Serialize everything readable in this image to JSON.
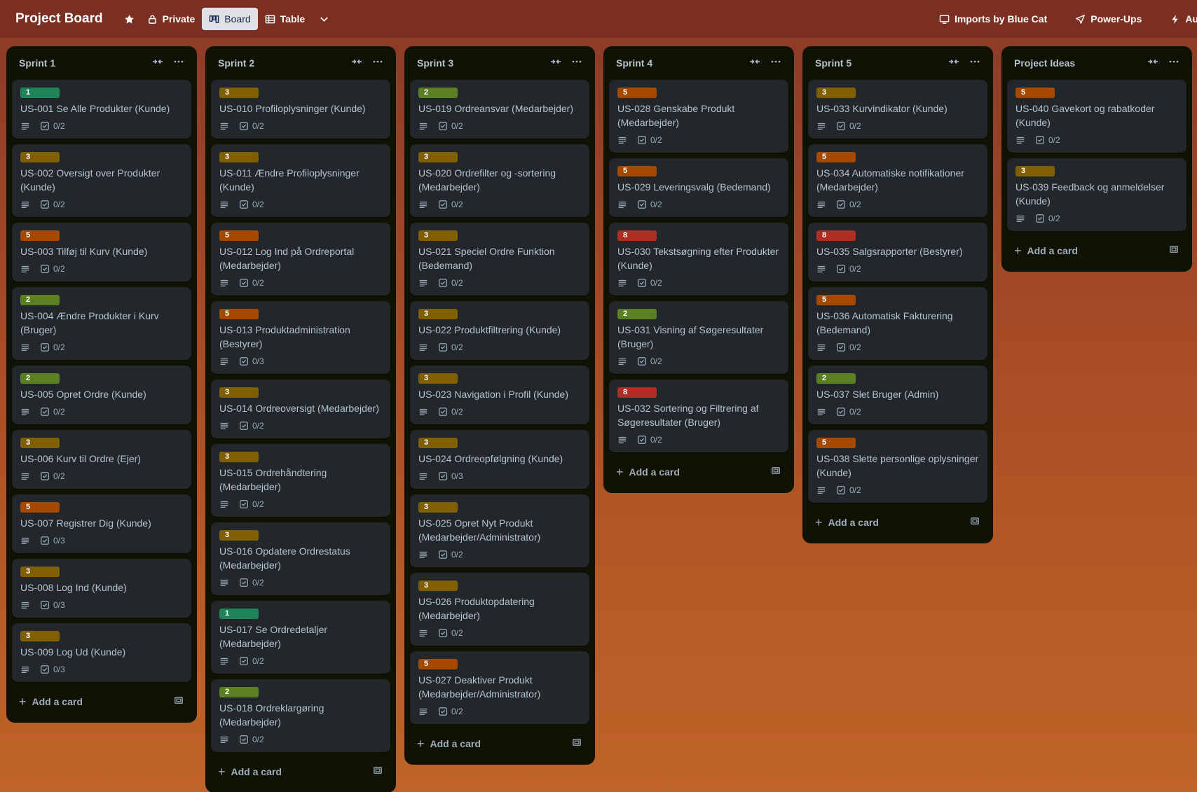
{
  "topbar": {
    "board_title": "Project Board",
    "visibility": "Private",
    "views": [
      "Board",
      "Table"
    ],
    "right_items": [
      "Imports by Blue Cat",
      "Power-Ups",
      "Automa"
    ]
  },
  "label_colors": {
    "1": "#1f845a",
    "2": "#5b7f24",
    "3": "#7f5f01",
    "5": "#a54800",
    "8": "#ae2e24"
  },
  "add_card_label": "Add a card",
  "lists": [
    {
      "title": "Sprint 1",
      "cards": [
        {
          "points": "1",
          "title": "US-001 Se Alle Produkter (Kunde)",
          "checklist": "0/2"
        },
        {
          "points": "3",
          "title": "US-002 Oversigt over Produkter (Kunde)",
          "checklist": "0/2"
        },
        {
          "points": "5",
          "title": "US-003 Tilføj til Kurv (Kunde)",
          "checklist": "0/2"
        },
        {
          "points": "2",
          "title": "US-004 Ændre Produkter i Kurv (Bruger)",
          "checklist": "0/2"
        },
        {
          "points": "2",
          "title": "US-005 Opret Ordre (Kunde)",
          "checklist": "0/2"
        },
        {
          "points": "3",
          "title": "US-006 Kurv til Ordre (Ejer)",
          "checklist": "0/2"
        },
        {
          "points": "5",
          "title": "US-007 Registrer Dig (Kunde)",
          "checklist": "0/3"
        },
        {
          "points": "3",
          "title": "US-008 Log Ind (Kunde)",
          "checklist": "0/3"
        },
        {
          "points": "3",
          "title": "US-009 Log Ud (Kunde)",
          "checklist": "0/3"
        }
      ]
    },
    {
      "title": "Sprint 2",
      "cards": [
        {
          "points": "3",
          "title": "US-010 Profiloplysninger (Kunde)",
          "checklist": "0/2"
        },
        {
          "points": "3",
          "title": "US-011 Ændre Profiloplysninger (Kunde)",
          "checklist": "0/2"
        },
        {
          "points": "5",
          "title": "US-012 Log Ind på Ordreportal (Medarbejder)",
          "checklist": "0/2"
        },
        {
          "points": "5",
          "title": "US-013 Produktadministration (Bestyrer)",
          "checklist": "0/3"
        },
        {
          "points": "3",
          "title": "US-014 Ordreoversigt (Medarbejder)",
          "checklist": "0/2"
        },
        {
          "points": "3",
          "title": "US-015 Ordrehåndtering (Medarbejder)",
          "checklist": "0/2"
        },
        {
          "points": "3",
          "title": "US-016 Opdatere Ordrestatus (Medarbejder)",
          "checklist": "0/2"
        },
        {
          "points": "1",
          "title": "US-017 Se Ordredetaljer (Medarbejder)",
          "checklist": "0/2"
        },
        {
          "points": "2",
          "title": "US-018 Ordreklargøring (Medarbejder)",
          "checklist": "0/2"
        }
      ]
    },
    {
      "title": "Sprint 3",
      "cards": [
        {
          "points": "2",
          "title": "US-019 Ordreansvar (Medarbejder)",
          "checklist": "0/2"
        },
        {
          "points": "3",
          "title": "US-020 Ordrefilter og -sortering (Medarbejder)",
          "checklist": "0/2"
        },
        {
          "points": "3",
          "title": "US-021 Speciel Ordre Funktion (Bedemand)",
          "checklist": "0/2"
        },
        {
          "points": "3",
          "title": "US-022 Produktfiltrering (Kunde)",
          "checklist": "0/2"
        },
        {
          "points": "3",
          "title": "US-023 Navigation i Profil (Kunde)",
          "checklist": "0/2"
        },
        {
          "points": "3",
          "title": "US-024 Ordreopfølgning (Kunde)",
          "checklist": "0/3"
        },
        {
          "points": "3",
          "title": "US-025 Opret Nyt Produkt (Medarbejder/Administrator)",
          "checklist": "0/2"
        },
        {
          "points": "3",
          "title": "US-026 Produktopdatering (Medarbejder)",
          "checklist": "0/2"
        },
        {
          "points": "5",
          "title": "US-027 Deaktiver Produkt (Medarbejder/Administrator)",
          "checklist": "0/2"
        }
      ]
    },
    {
      "title": "Sprint 4",
      "cards": [
        {
          "points": "5",
          "title": "US-028 Genskabe Produkt (Medarbejder)",
          "checklist": "0/2"
        },
        {
          "points": "5",
          "title": "US-029 Leveringsvalg (Bedemand)",
          "checklist": "0/2"
        },
        {
          "points": "8",
          "title": "US-030 Tekstsøgning efter Produkter (Kunde)",
          "checklist": "0/2"
        },
        {
          "points": "2",
          "title": "US-031 Visning af Søgeresultater (Bruger)",
          "checklist": "0/2"
        },
        {
          "points": "8",
          "title": "US-032 Sortering og Filtrering af Søgeresultater (Bruger)",
          "checklist": "0/2"
        }
      ]
    },
    {
      "title": "Sprint 5",
      "cards": [
        {
          "points": "3",
          "title": "US-033 Kurvindikator (Kunde)",
          "checklist": "0/2"
        },
        {
          "points": "5",
          "title": "US-034 Automatiske notifikationer (Medarbejder)",
          "checklist": "0/2"
        },
        {
          "points": "8",
          "title": "US-035 Salgsrapporter (Bestyrer)",
          "checklist": "0/2"
        },
        {
          "points": "5",
          "title": "US-036 Automatisk Fakturering (Bedemand)",
          "checklist": "0/2"
        },
        {
          "points": "2",
          "title": "US-037 Slet Bruger (Admin)",
          "checklist": "0/2"
        },
        {
          "points": "5",
          "title": "US-038 Slette personlige oplysninger (Kunde)",
          "checklist": "0/2"
        }
      ]
    },
    {
      "title": "Project Ideas",
      "cards": [
        {
          "points": "5",
          "title": "US-040 Gavekort og rabatkoder (Kunde)",
          "checklist": "0/2"
        },
        {
          "points": "3",
          "title": "US-039 Feedback og anmeldelser (Kunde)",
          "checklist": "0/2"
        }
      ]
    }
  ]
}
